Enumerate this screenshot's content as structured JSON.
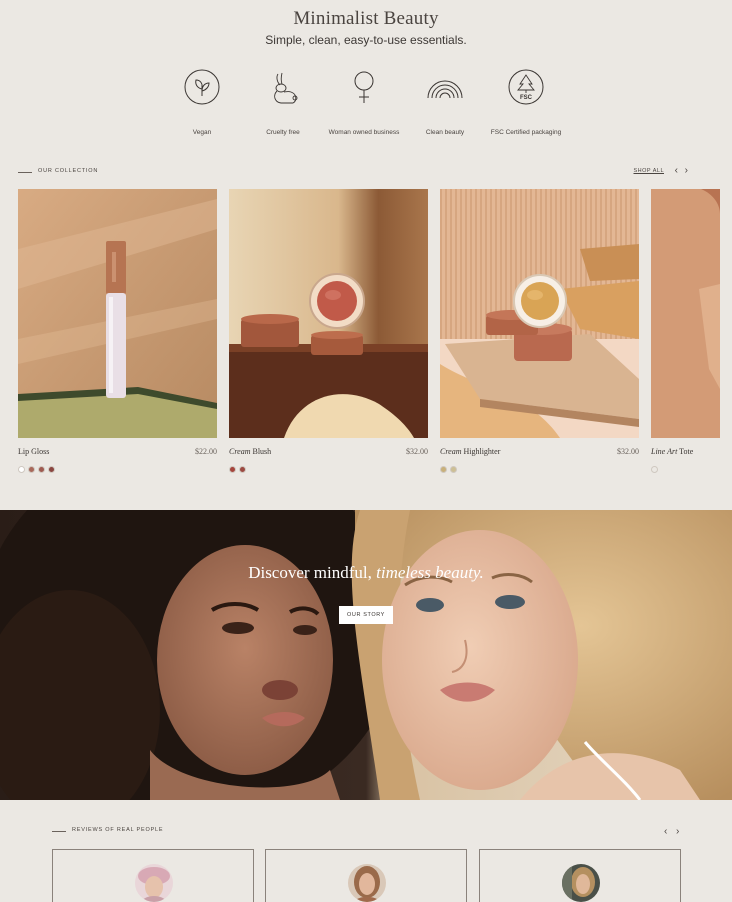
{
  "brand": {
    "title": "Minimalist Beauty",
    "tagline": "Simple, clean, easy-to-use essentials."
  },
  "values": [
    {
      "label": "Vegan",
      "icon": "leaf-icon"
    },
    {
      "label": "Cruelty free",
      "icon": "bunny-icon"
    },
    {
      "label": "Woman owned business",
      "icon": "female-symbol-icon"
    },
    {
      "label": "Clean beauty",
      "icon": "rainbow-icon"
    },
    {
      "label": "FSC Certified packaging",
      "icon": "fsc-tree-icon"
    }
  ],
  "collection": {
    "title": "OUR COLLECTION",
    "shop_all": "SHOP ALL",
    "prev": "‹",
    "next": "›",
    "products": [
      {
        "name_em": "",
        "name": "Lip Gloss",
        "price": "$22.00",
        "swatches": [
          "#ffffff",
          "#a8685a",
          "#9e5a50",
          "#8a4640"
        ]
      },
      {
        "name_em": "Cream",
        "name": " Blush",
        "price": "$32.00",
        "swatches": [
          "#a5453c",
          "#9c4a42"
        ]
      },
      {
        "name_em": "Cream",
        "name": " Highlighter",
        "price": "$32.00",
        "swatches": [
          "#c8b07a",
          "#cdbf95"
        ]
      },
      {
        "name_em": "Line Art",
        "name": " Tote",
        "price": "",
        "swatches": [
          "#ebe8e3"
        ]
      }
    ]
  },
  "hero": {
    "text_plain": "Discover mindful, ",
    "text_em": "timeless beauty.",
    "button": "OUR STORY"
  },
  "reviews": {
    "title": "REVIEWS OF REAL PEOPLE",
    "prev": "‹",
    "next": "›"
  }
}
